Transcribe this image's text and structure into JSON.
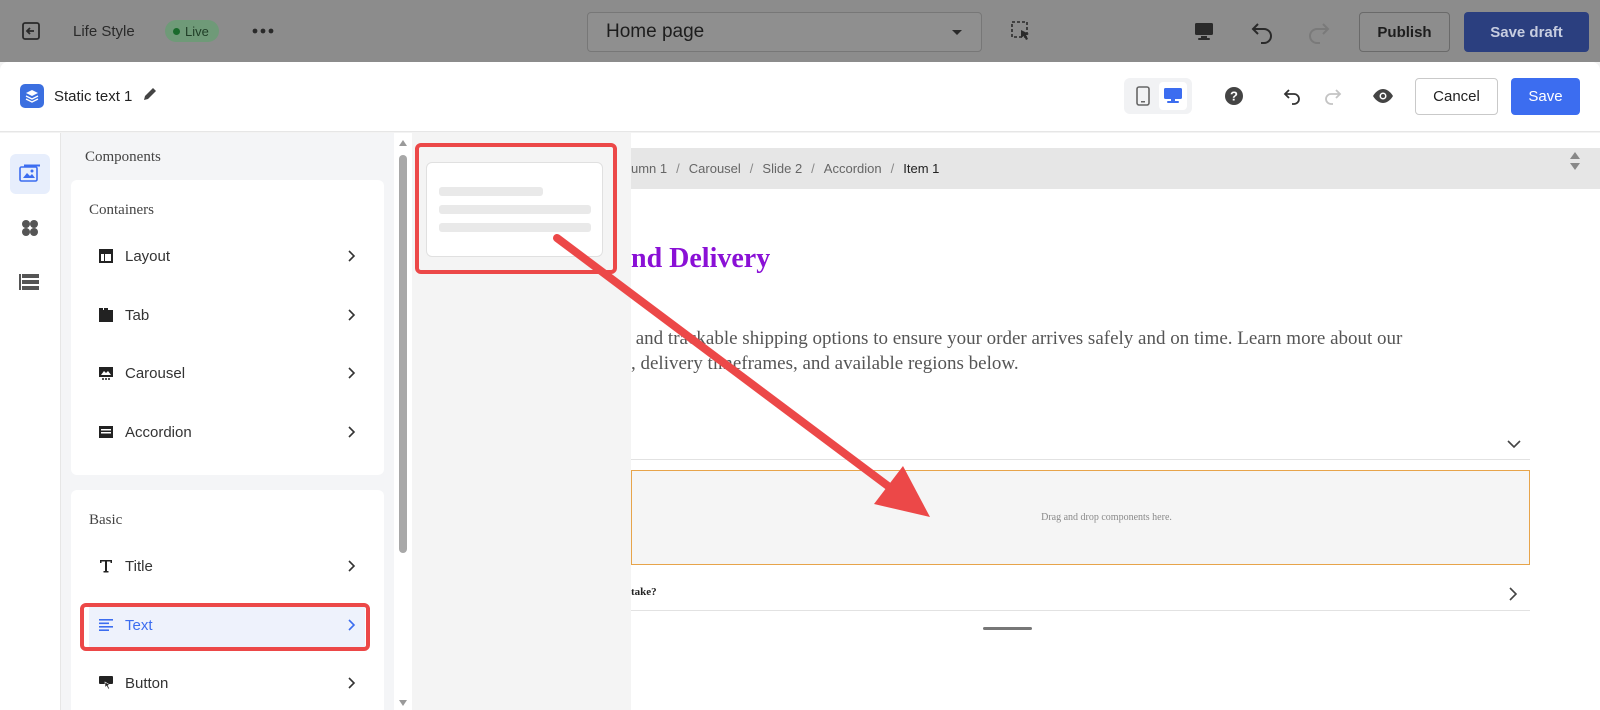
{
  "topbar": {
    "site_title": "Life Style",
    "live_label": "Live",
    "page_selector": "Home page",
    "publish_label": "Publish",
    "save_draft_label": "Save draft"
  },
  "editor": {
    "title": "Static text 1",
    "cancel_label": "Cancel",
    "save_label": "Save"
  },
  "panel": {
    "heading": "Components",
    "containers": {
      "heading": "Containers",
      "items": [
        {
          "label": "Layout",
          "icon": "layout-icon"
        },
        {
          "label": "Tab",
          "icon": "tab-icon"
        },
        {
          "label": "Carousel",
          "icon": "carousel-icon"
        },
        {
          "label": "Accordion",
          "icon": "accordion-icon"
        }
      ]
    },
    "basic": {
      "heading": "Basic",
      "items": [
        {
          "label": "Title",
          "icon": "title-icon"
        },
        {
          "label": "Text",
          "icon": "text-icon",
          "selected": true
        },
        {
          "label": "Button",
          "icon": "button-icon"
        }
      ]
    }
  },
  "canvas": {
    "breadcrumb": [
      "umn 1",
      "Carousel",
      "Slide 2",
      "Accordion",
      "Item 1"
    ],
    "heading": "nd Delivery",
    "paragraph_line1": " and trackable shipping options to ensure your order arrives safely and on time. Learn more about our",
    "paragraph_line2": ", delivery timeframes, and available regions below.",
    "drop_text": "Drag and drop components here.",
    "question_text": "take?"
  },
  "colors": {
    "accent": "#3c6df0",
    "highlight": "#ec4848",
    "heading": "#8a10d6",
    "drop_border": "#e7a44a"
  }
}
